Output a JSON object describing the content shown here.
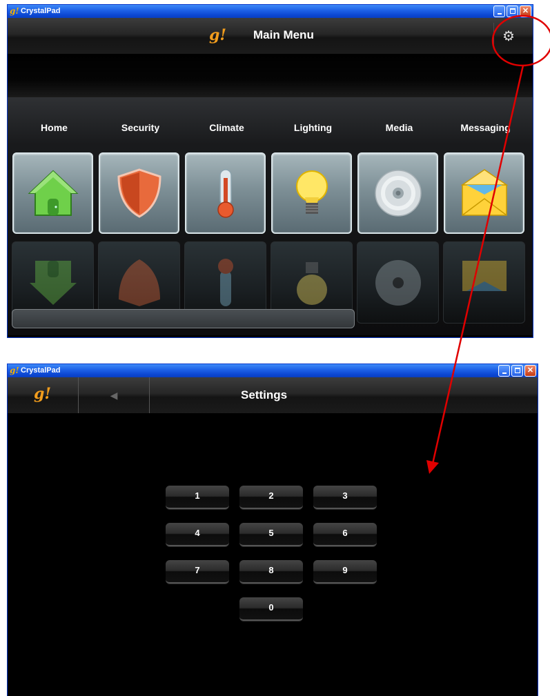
{
  "colors": {
    "title_bar": "#0a46d2",
    "logo": "#f29d1d",
    "annotation": "#e00000"
  },
  "window_main": {
    "app_title": "CrystalPad",
    "logo": "g!",
    "header_title": "Main Menu",
    "settings_icon": "gear-icon",
    "categories": [
      {
        "label": "Home",
        "icon": "house-icon"
      },
      {
        "label": "Security",
        "icon": "shield-icon"
      },
      {
        "label": "Climate",
        "icon": "thermometer-icon"
      },
      {
        "label": "Lighting",
        "icon": "light-bulb-icon"
      },
      {
        "label": "Media",
        "icon": "disc-icon"
      },
      {
        "label": "Messaging",
        "icon": "envelope-icon"
      }
    ]
  },
  "window_settings": {
    "app_title": "CrystalPad",
    "logo": "g!",
    "back_icon": "back-arrow-icon",
    "header_title": "Settings",
    "keypad": [
      "1",
      "2",
      "3",
      "4",
      "5",
      "6",
      "7",
      "8",
      "9",
      "0"
    ]
  },
  "annotation": {
    "shape": "red-circle",
    "target": "gear-icon",
    "arrow_to": "settings-window"
  }
}
